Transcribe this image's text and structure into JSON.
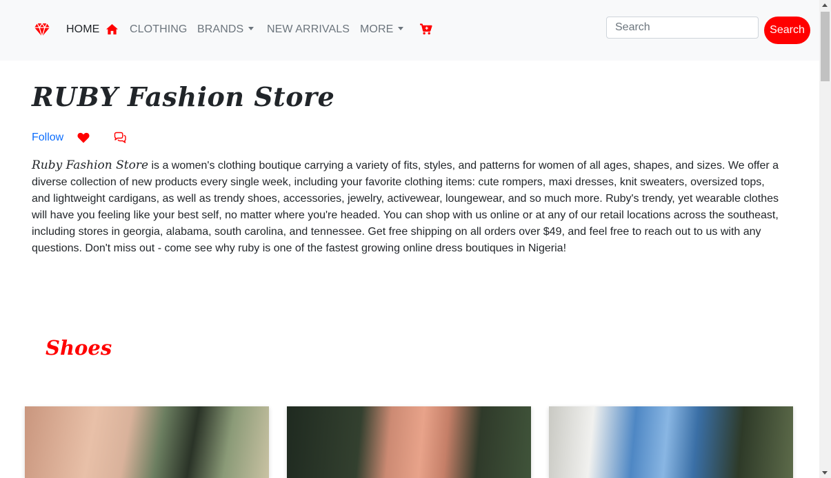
{
  "colors": {
    "accent": "#ff0000",
    "link": "#0d6efd",
    "navbar_bg": "#f8f9fa",
    "nav_text": "#6c757d"
  },
  "navbar": {
    "logo_icon": "diamond-gem-icon",
    "items": [
      {
        "label": "HOME",
        "icon": "home-icon"
      },
      {
        "label": "CLOTHING"
      },
      {
        "label": "BRANDS"
      },
      {
        "label": "NEW ARRIVALS"
      },
      {
        "label": "MORE"
      }
    ],
    "cart_icon": "cart-plus-icon",
    "search": {
      "placeholder": "Search",
      "value": "",
      "button_label": "Search"
    }
  },
  "main": {
    "title": "RUBY Fashion Store",
    "follow_label": "Follow",
    "heart_icon": "heart-icon",
    "comments_icon": "comments-icon",
    "about": {
      "brand": "Ruby Fashion Store",
      "text": " is a women's clothing boutique carrying a variety of fits, styles, and patterns for women of all ages, shapes, and sizes. We offer a diverse collection of new products every single week, including your favorite clothing items: cute rompers, maxi dresses, knit sweaters, oversized tops, and lightweight cardigans, as well as trendy shoes, accessories, jewelry, activewear, loungewear, and so much more. Ruby's trendy, yet wearable clothes will have you feeling like your best self, no matter where you're headed. You can shop with us online or at any of our retail locations across the southeast, including stores in georgia, alabama, south carolina, and tennessee. Get free shipping on all orders over $49, and feel free to reach out to us with any questions. Don't miss out - come see why ruby is one of the fastest growing online dress boutiques in Nigeria!"
    },
    "section_title": "Shoes"
  }
}
